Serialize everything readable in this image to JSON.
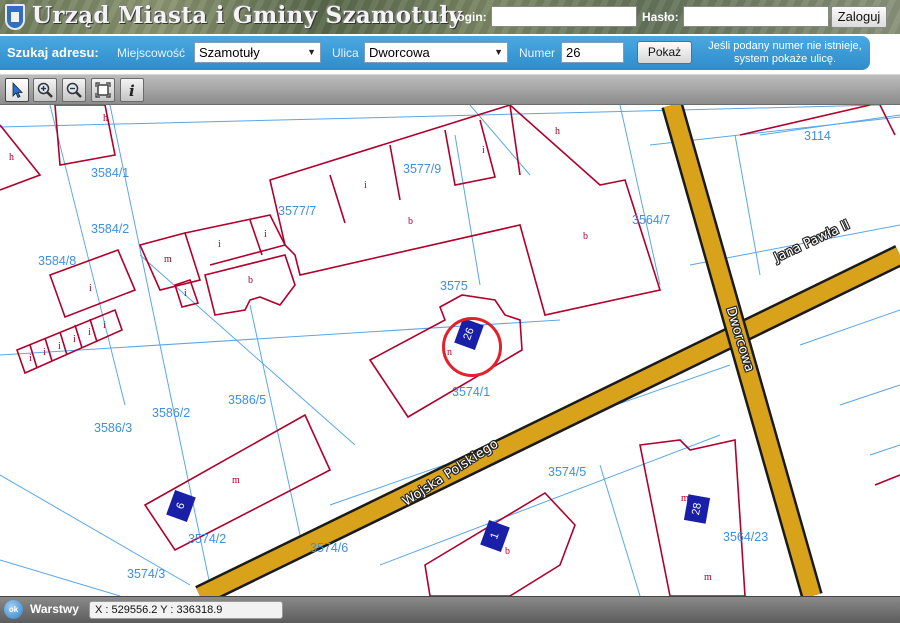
{
  "header": {
    "title": "Urząd Miasta i Gminy Szamotuły",
    "login_label": "Login:",
    "login_value": "",
    "password_label": "Hasło:",
    "password_value": "",
    "login_button": "Zaloguj",
    "crest_icon": "coat-of-arms-icon"
  },
  "search": {
    "title": "Szukaj adresu:",
    "locality_label": "Miejscowość",
    "locality_value": "Szamotuły",
    "street_label": "Ulica",
    "street_value": "Dworcowa",
    "number_label": "Numer",
    "number_value": "26",
    "show_button": "Pokaż",
    "hint_line1": "Jeśli podany numer nie istnieje,",
    "hint_line2": "system pokaże ulicę."
  },
  "toolbar": {
    "tools": [
      "pointer-icon",
      "zoom-in-icon",
      "zoom-out-icon",
      "full-extent-icon",
      "info-icon"
    ]
  },
  "map": {
    "parcels": [
      "3584/1",
      "3584/2",
      "3584/8",
      "3577/7",
      "3577/9",
      "3575",
      "3564/7",
      "3114",
      "3574/1",
      "3586/5",
      "3586/2",
      "3586/3",
      "3574/5",
      "3574/2",
      "3574/6",
      "3574/3",
      "3564/23"
    ],
    "building_codes": [
      "h",
      "h",
      "h",
      "i",
      "i",
      "i",
      "i",
      "i",
      "b",
      "b",
      "b",
      "m",
      "i",
      "i",
      "i",
      "i",
      "i",
      "i",
      "i",
      "n",
      "m",
      "b",
      "m",
      "m"
    ],
    "streets": [
      "Jana Pawła II",
      "Dworcowa",
      "Wojska Polskiego"
    ],
    "house_numbers": [
      "26",
      "6",
      "1",
      "28"
    ],
    "colors": {
      "road": "#d9a21b",
      "road_outline": "#1a1a1a",
      "building": "#b0002c",
      "parcel_line": "#5aa6e8",
      "house_number_bg": "#1a1fa8",
      "target_circle": "#e4202c"
    }
  },
  "statusbar": {
    "ok_icon": "ok",
    "layers_label": "Warstwy",
    "coordinates": "X : 529556.2  Y : 336318.9"
  }
}
